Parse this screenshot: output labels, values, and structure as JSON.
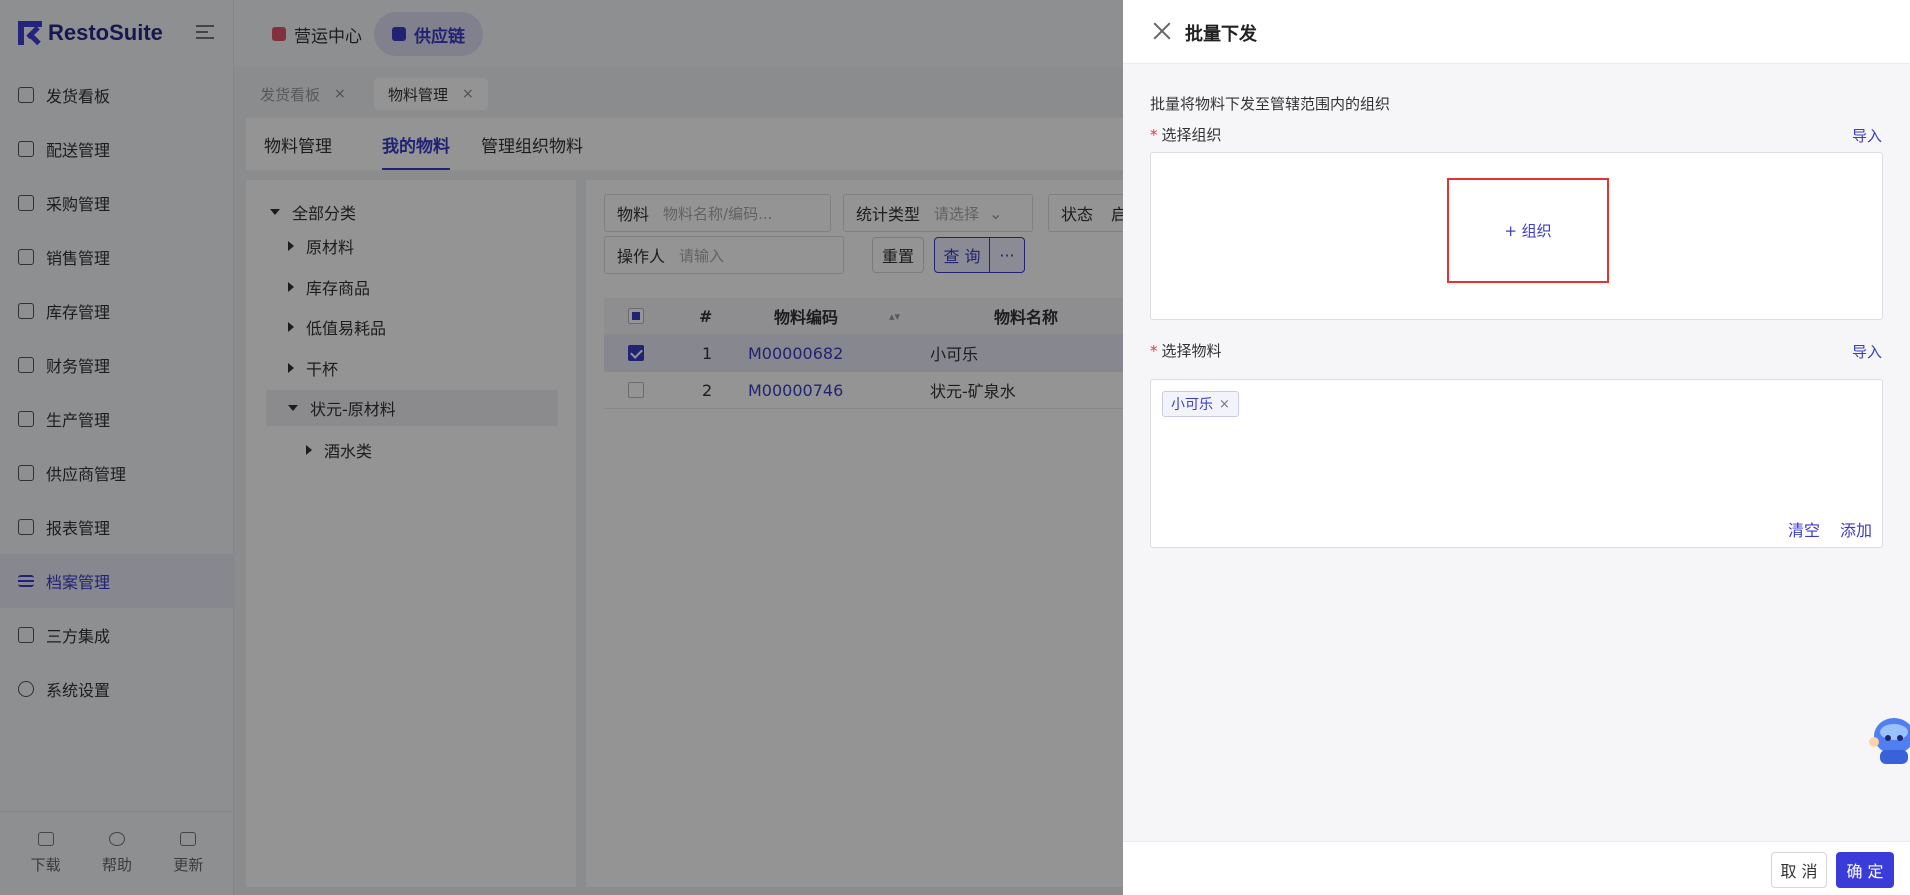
{
  "app": {
    "brand": "RestoSuite",
    "modules": [
      "营运中心",
      "供应链"
    ],
    "active_module": "供应链"
  },
  "sidebar": {
    "items": [
      {
        "label": "发货看板",
        "icon": "monitor-icon"
      },
      {
        "label": "配送管理",
        "icon": "truck-icon"
      },
      {
        "label": "采购管理",
        "icon": "cart-icon"
      },
      {
        "label": "销售管理",
        "icon": "bag-icon"
      },
      {
        "label": "库存管理",
        "icon": "warehouse-icon"
      },
      {
        "label": "财务管理",
        "icon": "money-icon"
      },
      {
        "label": "生产管理",
        "icon": "chef-icon"
      },
      {
        "label": "供应商管理",
        "icon": "building-icon"
      },
      {
        "label": "报表管理",
        "icon": "report-icon"
      },
      {
        "label": "档案管理",
        "icon": "list-icon"
      },
      {
        "label": "三方集成",
        "icon": "link-icon"
      },
      {
        "label": "系统设置",
        "icon": "gear-icon"
      }
    ],
    "active": "档案管理",
    "footer": [
      "下载",
      "帮助",
      "更新"
    ]
  },
  "page_tabs": [
    {
      "label": "发货看板",
      "close": "×"
    },
    {
      "label": "物料管理",
      "close": "×"
    }
  ],
  "sub_tabs": [
    "物料管理",
    "我的物料",
    "管理组织物料"
  ],
  "tree": [
    {
      "label": "全部分类"
    },
    {
      "label": "原材料"
    },
    {
      "label": "库存商品"
    },
    {
      "label": "低值易耗品"
    },
    {
      "label": "干杯"
    },
    {
      "label": "状元-原材料"
    },
    {
      "label": "酒水类"
    }
  ],
  "filters": {
    "material_label": "物料",
    "material_placeholder": "物料名称/编码...",
    "stat_type_label": "统计类型",
    "stat_type_placeholder": "请选择",
    "status_label": "状态",
    "status_value": "启",
    "operator_label": "操作人",
    "operator_placeholder": "请输入",
    "reset": "重置",
    "query": "查 询",
    "more": "···"
  },
  "table": {
    "headers": [
      "#",
      "物料编码",
      "物料名称"
    ],
    "rows": [
      {
        "index": "1",
        "code": "M00000682",
        "name": "小可乐"
      },
      {
        "index": "2",
        "code": "M00000746",
        "name": "状元-矿泉水"
      }
    ]
  },
  "drawer": {
    "title": "批量下发",
    "description": "批量将物料下发至管辖范围内的组织",
    "org_label": "选择组织",
    "org_required": "*",
    "org_import": "导入",
    "org_add": "+ 组织",
    "material_label": "选择物料",
    "material_required": "*",
    "material_import": "导入",
    "selected_tags": [
      {
        "label": "小可乐",
        "remove": "×"
      }
    ],
    "clear": "清空",
    "add": "添加",
    "cancel": "取 消",
    "confirm": "确 定"
  },
  "colors": {
    "primary": "#3b3bd9",
    "highlight_border": "#e53232",
    "required": "#e33333"
  }
}
